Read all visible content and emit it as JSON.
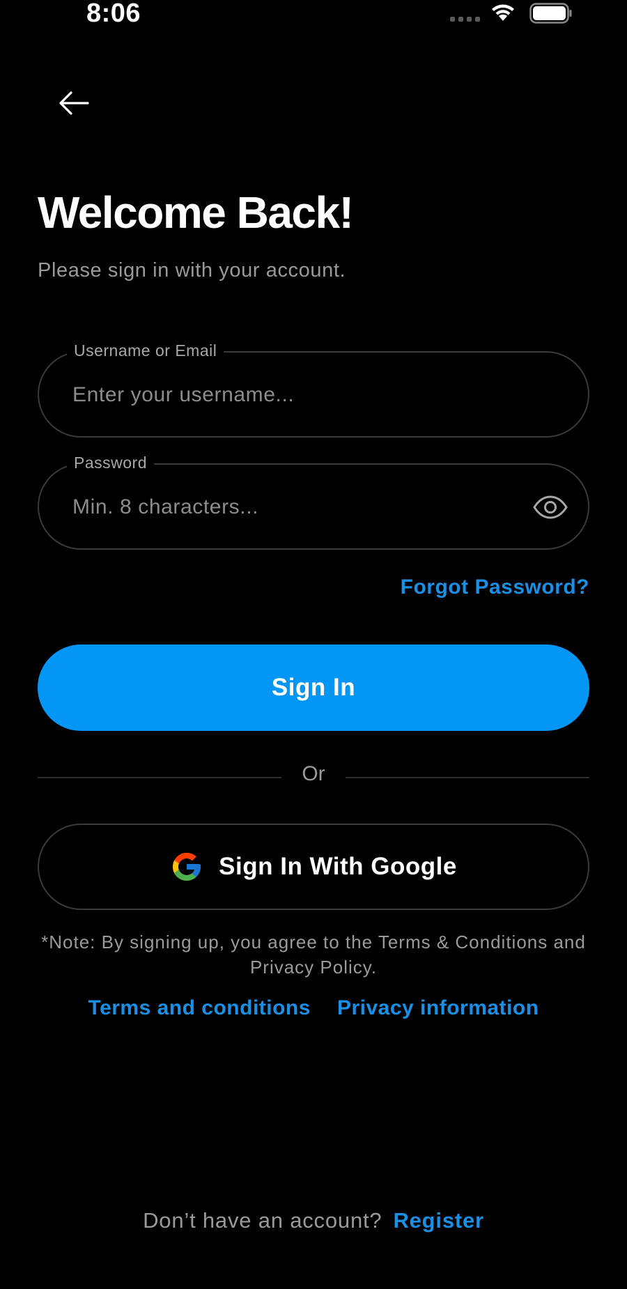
{
  "status_bar": {
    "time": "8:06"
  },
  "header": {
    "title": "Welcome Back!",
    "subtitle": "Please sign in with your account."
  },
  "form": {
    "username": {
      "label": "Username or Email",
      "placeholder": "Enter your username...",
      "value": ""
    },
    "password": {
      "label": "Password",
      "placeholder": "Min. 8 characters...",
      "value": ""
    },
    "forgot_password_label": "Forgot Password?",
    "sign_in_label": "Sign In"
  },
  "divider_label": "Or",
  "google_sign_in_label": "Sign In With Google",
  "legal": {
    "note": "*Note: By signing up, you agree to the Terms & Conditions and Privacy Policy.",
    "terms_label": "Terms and conditions",
    "privacy_label": "Privacy information"
  },
  "footer": {
    "prompt": "Don’t have an account?",
    "register_label": "Register"
  },
  "colors": {
    "background": "#000000",
    "accent": "#0496F5",
    "link": "#1A8FE3",
    "border": "#3A3A3A"
  },
  "icons": {
    "back": "arrow-left-icon",
    "password_toggle": "eye-icon",
    "google": "google-logo-icon"
  }
}
